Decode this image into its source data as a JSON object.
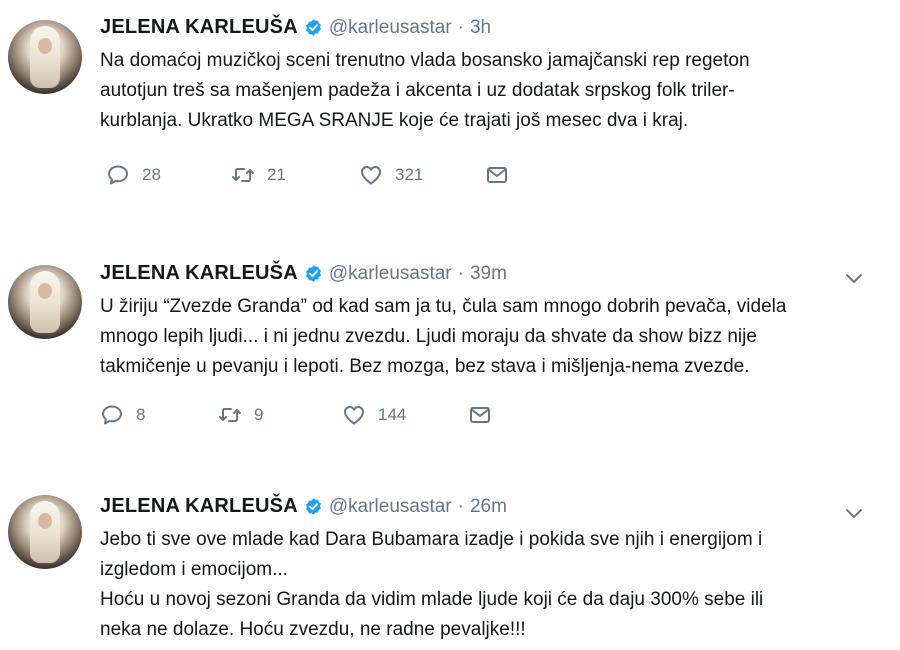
{
  "tweets": [
    {
      "name": "JELENA KARLEUŠA",
      "handle": "@karleusastar",
      "separator": "·",
      "time": "3h",
      "lines": [
        "Na domaćoj muzičkoj sceni trenutno vlada bosansko jamajčanski rep regeton",
        "autotjun treš sa mašenjem padeža i akcenta i uz dodatak srpskog folk triler-",
        "kurblanja. Ukratko MEGA SRANJE koje će trajati još mesec dva i kraj."
      ],
      "replies": "28",
      "retweets": "21",
      "likes": "321"
    },
    {
      "name": "JELENA KARLEUŠA",
      "handle": "@karleusastar",
      "separator": "·",
      "time": "39m",
      "lines": [
        "U žiriju “Zvezde Granda” od kad sam ja tu, čula sam mnogo dobrih pevača, videla",
        "mnogo lepih ljudi... i ni jednu zvezdu. Ljudi moraju da shvate da show bizz nije",
        "takmičenje u pevanju i lepoti. Bez mozga, bez stava i mišljenja-nema zvezde."
      ],
      "replies": "8",
      "retweets": "9",
      "likes": "144"
    },
    {
      "name": "JELENA KARLEUŠA",
      "handle": "@karleusastar",
      "separator": "·",
      "time": "26m",
      "lines": [
        "Jebo ti sve ove mlade kad Dara Bubamara izadje i pokida sve njih i energijom i",
        "izgledom i emocijom...",
        "Hoću u novoj sezoni Granda da vidim mlade ljude koji će da daju 300% sebe ili",
        "neka ne dolaze. Hoću zvezdu, ne radne pevaljke!!!"
      ]
    }
  ],
  "colors": {
    "verified": "#1da1f2",
    "icon": "#657786",
    "text": "#14171a"
  },
  "icons": {
    "reply": "speech-bubble-icon",
    "retweet": "retweet-arrows-icon",
    "like": "heart-outline-icon",
    "message": "envelope-icon",
    "more": "chevron-down-icon",
    "verified": "verified-badge-icon"
  }
}
